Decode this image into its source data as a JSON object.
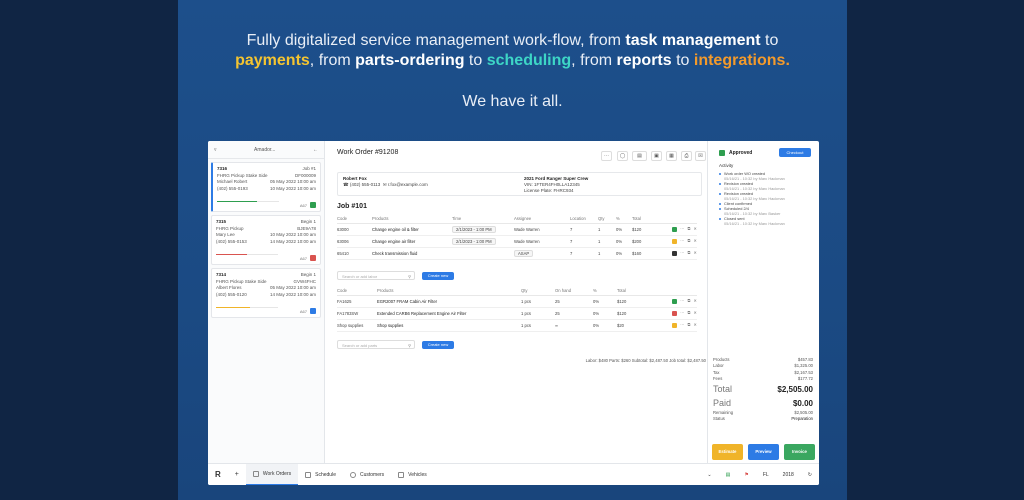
{
  "headline": {
    "line1_a": "Fully digitalized service management work-flow, from ",
    "line1_b": "task management",
    "line1_c": " to",
    "line2_a": "payments",
    "line2_b": ", from ",
    "line2_c": "parts-ordering",
    "line2_d": " to ",
    "line2_e": "scheduling",
    "line2_f": ", from ",
    "line2_g": "reports",
    "line2_h": " to ",
    "line2_i": "integrations.",
    "tagline": "We have it all."
  },
  "colors": {
    "accent": "#2d7be5",
    "approved": "#2e9e4f",
    "estimate": "#f0b429",
    "invoice": "#3aa760",
    "background": "#1b4a83"
  },
  "sidebar": {
    "filter_icon": "filter-icon",
    "filter_label": "Amador...",
    "back_icon": "arrow-left-icon",
    "cards": [
      {
        "num": "7316",
        "status": "Job #1",
        "model": "FHRG Pickup Stake Side",
        "code": "DF000009",
        "name": "Michael Robert",
        "date": "05 May 2022 10:00 am",
        "phone": "(402) 555-0193",
        "due": "10 May 2022 10:00 am",
        "tag": "A67",
        "progress": 0.65,
        "bar_color": "#2e9e4f",
        "check_color": "#2e9e4f"
      },
      {
        "num": "7315",
        "status": "Begin 1",
        "model": "FHRG Pickup",
        "code": "BJE9A78",
        "name": "Mary Lee",
        "date": "10 May 2022 10:00 am",
        "phone": "(402) 555-0153",
        "due": "14 May 2022 10:00 am",
        "tag": "A67",
        "progress": 0.5,
        "bar_color": "#d9534f",
        "check_color": "#d9534f"
      },
      {
        "num": "7314",
        "status": "Begin 1",
        "model": "FHRG Pickup Stake Side",
        "code": "GVW4FHC",
        "name": "Albert Flores",
        "date": "05 May 2022 10:00 am",
        "phone": "(402) 555-0120",
        "due": "14 May 2022 10:00 am",
        "tag": "A67",
        "progress": 0.55,
        "bar_color": "#f0b429",
        "check_color": "#2d7be5"
      }
    ]
  },
  "workorder": {
    "title": "Work Order #91208",
    "customer_title": "Robert Fox",
    "customer_phone": "(402) 555-0113",
    "customer_email": "r.fox@example.com",
    "vehicle_title": "2021 Ford Ranger Super Crew",
    "vehicle_vin": "VIN: 1FTER4FH0LLA12345",
    "vehicle_plate": "License Plate: FHRC934",
    "job_title": "Job #101",
    "labor_headers": [
      "Code",
      "Products",
      "Time",
      "Assignee",
      "Location",
      "Qty",
      "%",
      "Total"
    ],
    "labor": [
      {
        "code": "63000",
        "desc": "Change engine oil & filter",
        "time": "2/1/2023 - 1:00 PM",
        "assignee": "Wade Warren",
        "loc": "7",
        "qty": "1",
        "pct": "0%",
        "total": "$120",
        "sq": "#2e9e4f"
      },
      {
        "code": "63006",
        "desc": "Change engine air filter",
        "time": "2/1/2023 - 1:00 PM",
        "assignee": "Wade Warren",
        "loc": "7",
        "qty": "1",
        "pct": "0%",
        "total": "$200",
        "sq": "#f0b429"
      },
      {
        "code": "65410",
        "desc": "Check transmission fluid",
        "time": "",
        "assignee": "ASAP",
        "loc": "7",
        "qty": "1",
        "pct": "0%",
        "total": "$160",
        "sq": "#333333"
      }
    ],
    "labor_search_placeholder": "Search or add labor",
    "labor_add": "Create new",
    "parts_headers": [
      "Code",
      "Products",
      "Qty",
      "On hand",
      "%",
      "Total"
    ],
    "parts": [
      {
        "code": "FA1625",
        "desc": "EGR2007 FRAM Cabin Air Filter",
        "qty": "1 pcs",
        "hand": "25",
        "pct": "0%",
        "total": "$120",
        "sq": "#2e9e4f"
      },
      {
        "code": "FA1783SW",
        "desc": "Extended CARB6 Replacement Engine Air Filter",
        "qty": "1 pcs",
        "hand": "25",
        "pct": "0%",
        "total": "$120",
        "sq": "#d9534f"
      },
      {
        "code": "Shop supplies",
        "desc": "Shop supplies",
        "qty": "1 pcs",
        "hand": "∞",
        "pct": "0%",
        "total": "$20",
        "sq": "#f0b429"
      }
    ],
    "parts_search_placeholder": "Search or add parts",
    "parts_add": "Create new",
    "summary": "Labor: $480   Parts: $260   Subtotal: $2,487.50   Job total: $2,487.50"
  },
  "right": {
    "status": "Approved",
    "checkout": "Checkout",
    "activity_label": "Activity",
    "activities": [
      {
        "text": "Work order WO created",
        "sub": "05/16/21 - 10:32 by Marc Hackman"
      },
      {
        "text": "Revision created",
        "sub": "05/16/21 - 10:32 by Marc Hackman"
      },
      {
        "text": "Revision created",
        "sub": "05/16/21 - 10:32 by Marc Hackman"
      },
      {
        "text": "Client confirmed",
        "sub": ""
      },
      {
        "text": "Scheduled 2/4",
        "sub": "05/16/21 - 10:32 by Marc Basker"
      },
      {
        "text": "Closed sent",
        "sub": "05/16/21 - 10:32 by Marc Hackman"
      }
    ],
    "totals": [
      {
        "label": "Products",
        "value": "$457.83"
      },
      {
        "label": "Labor",
        "value": "$1,325.00"
      },
      {
        "label": "Tax",
        "value": "$2,167.53"
      },
      {
        "label": "Fees",
        "value": "$177.72"
      }
    ],
    "total_label": "Total",
    "total_value": "$2,505.00",
    "paid_label": "Paid",
    "paid_value": "$0.00",
    "remaining_label": "Remaining",
    "remaining_value": "$2,505.00",
    "state_label": "Status",
    "state_value": "Preparation",
    "btn_estimate": "Estimate",
    "btn_preview": "Preview",
    "btn_invoice": "Invoice"
  },
  "bottom": {
    "tabs": [
      "Work Orders",
      "Schedule",
      "Customers",
      "Vehicles"
    ],
    "page": "2018"
  }
}
